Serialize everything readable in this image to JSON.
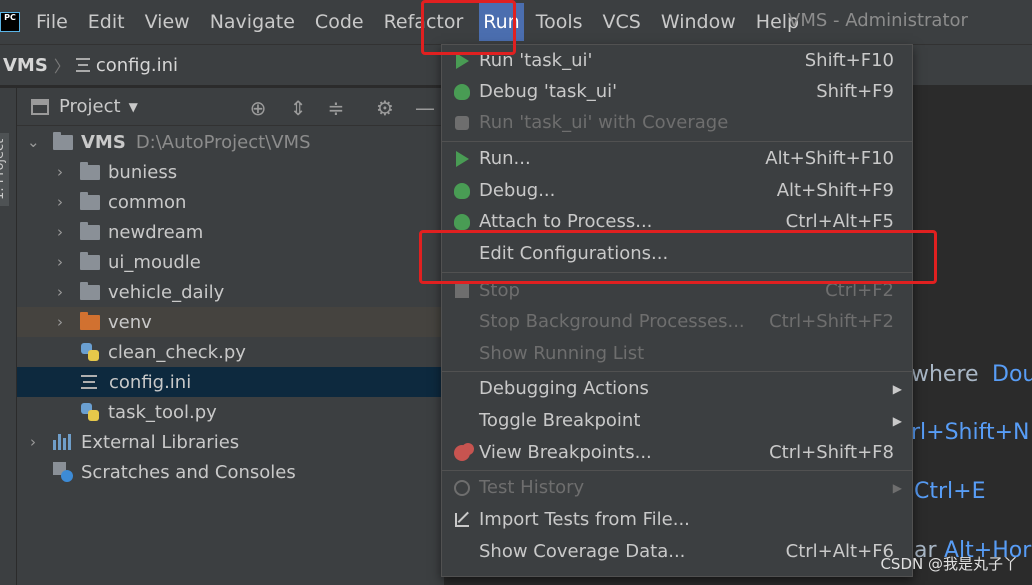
{
  "app": {
    "logo_text": "PC",
    "window_title": "VMS - Administrator"
  },
  "menubar": {
    "items": [
      "File",
      "Edit",
      "View",
      "Navigate",
      "Code",
      "Refactor",
      "Run",
      "Tools",
      "VCS",
      "Window",
      "Help"
    ],
    "active": "Run"
  },
  "breadcrumb": {
    "root": "VMS",
    "file": "config.ini"
  },
  "stripe": {
    "label": "1: Project"
  },
  "project_panel": {
    "title": "Project",
    "root": {
      "name": "VMS",
      "path": "D:\\AutoProject\\VMS"
    },
    "items": [
      {
        "label": "buniess",
        "type": "folder"
      },
      {
        "label": "common",
        "type": "folder"
      },
      {
        "label": "newdream",
        "type": "folder"
      },
      {
        "label": "ui_moudle",
        "type": "folder"
      },
      {
        "label": "vehicle_daily",
        "type": "folder"
      },
      {
        "label": "venv",
        "type": "folder-excluded"
      },
      {
        "label": "clean_check.py",
        "type": "python"
      },
      {
        "label": "config.ini",
        "type": "ini",
        "selected": true
      },
      {
        "label": "task_tool.py",
        "type": "python"
      }
    ],
    "external_libraries": "External Libraries",
    "scratches": "Scratches and Consoles"
  },
  "editor_hints": {
    "line1_a": "where",
    "line1_b": "Dou",
    "line2": "rl+Shift+N",
    "line3": "Ctrl+E",
    "line4_a": "ar",
    "line4_b": "Alt+Hor"
  },
  "run_menu": {
    "items": [
      {
        "label": "Run 'task_ui'",
        "shortcut": "Shift+F10",
        "icon": "run-icon",
        "enabled": true
      },
      {
        "label": "Debug 'task_ui'",
        "shortcut": "Shift+F9",
        "icon": "debug-icon",
        "enabled": true
      },
      {
        "label": "Run 'task_ui' with Coverage",
        "shortcut": "",
        "icon": "coverage-icon",
        "enabled": false
      },
      {
        "label": "Run...",
        "shortcut": "Alt+Shift+F10",
        "icon": "run-icon",
        "enabled": true
      },
      {
        "label": "Debug...",
        "shortcut": "Alt+Shift+F9",
        "icon": "debug-icon",
        "enabled": true
      },
      {
        "label": "Attach to Process...",
        "shortcut": "Ctrl+Alt+F5",
        "icon": "attach-icon",
        "enabled": true
      },
      {
        "label": "Edit Configurations...",
        "shortcut": "",
        "icon": "",
        "enabled": true
      },
      {
        "label": "Stop",
        "shortcut": "Ctrl+F2",
        "icon": "stop-icon",
        "enabled": false
      },
      {
        "label": "Stop Background Processes...",
        "shortcut": "Ctrl+Shift+F2",
        "icon": "",
        "enabled": false
      },
      {
        "label": "Show Running List",
        "shortcut": "",
        "icon": "",
        "enabled": false
      },
      {
        "label": "Debugging Actions",
        "shortcut": "",
        "icon": "",
        "enabled": true,
        "submenu": true
      },
      {
        "label": "Toggle Breakpoint",
        "shortcut": "",
        "icon": "",
        "enabled": true,
        "submenu": true
      },
      {
        "label": "View Breakpoints...",
        "shortcut": "Ctrl+Shift+F8",
        "icon": "breakpoints-icon",
        "enabled": true
      },
      {
        "label": "Test History",
        "shortcut": "",
        "icon": "clock-icon",
        "enabled": false,
        "submenu": true
      },
      {
        "label": "Import Tests from File...",
        "shortcut": "",
        "icon": "import-icon",
        "enabled": true
      },
      {
        "label": "Show Coverage Data...",
        "shortcut": "Ctrl+Alt+F6",
        "icon": "",
        "enabled": true
      }
    ]
  },
  "watermark": "CSDN @我是丸子丫",
  "colors": {
    "menubar_bg": "#3c3f41",
    "active_menu": "#4b6eaf",
    "highlight_red": "#e02020",
    "selection_bg": "#0d293e",
    "link_blue": "#589df6"
  }
}
